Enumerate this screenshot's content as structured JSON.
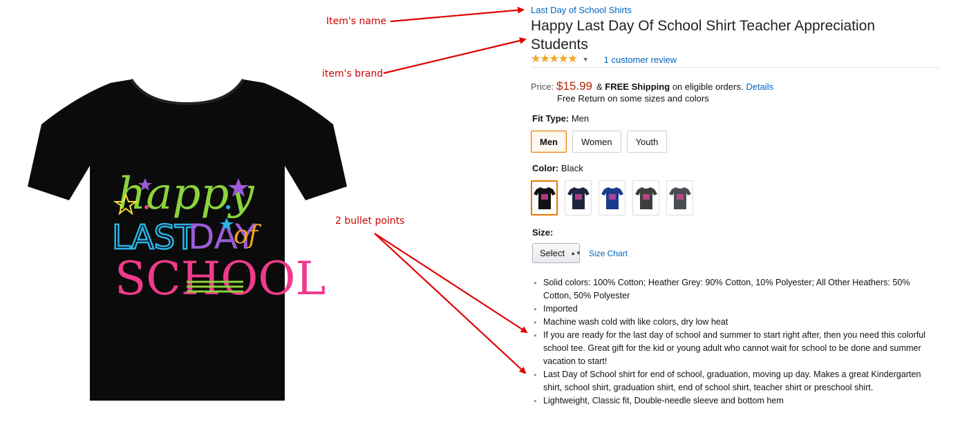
{
  "annotations": {
    "item_name": "Item's name",
    "item_brand": "item's brand",
    "bullet_points": "2 bullet points"
  },
  "product": {
    "brand": "Last Day of School Shirts",
    "title": "Happy Last Day Of School Shirt Teacher Appreciation Students",
    "rating": 5,
    "review_count_label": "1 customer review",
    "price_label": "Price:",
    "price": "$15.99",
    "shipping_amp": "&",
    "free_shipping": "FREE Shipping",
    "shipping_tail": "on eligible orders.",
    "details_link": "Details",
    "free_return": "Free Return on some sizes and colors",
    "fit_type_label": "Fit Type:",
    "fit_type_value": "Men",
    "fit_options": [
      "Men",
      "Women",
      "Youth"
    ],
    "color_label": "Color:",
    "color_value": "Black",
    "color_swatches": [
      "#111111",
      "#1f2540",
      "#1c3a8c",
      "#3d3f3d",
      "#4a4d52"
    ],
    "size_label": "Size:",
    "size_select": "Select",
    "size_chart": "Size Chart",
    "bullets": [
      "Solid colors: 100% Cotton; Heather Grey: 90% Cotton, 10% Polyester; All Other Heathers: 50% Cotton, 50% Polyester",
      "Imported",
      "Machine wash cold with like colors, dry low heat",
      "If you are ready for the last day of school and summer to start right after, then you need this colorful school tee. Great gift for the kid or young adult who cannot wait for school to be done and summer vacation to start!",
      "Last Day of School shirt for end of school, graduation, moving up day. Makes a great Kindergarten shirt, school shirt, graduation shirt, end of school shirt, teacher shirt or preschool shirt.",
      "Lightweight, Classic fit, Double-needle sleeve and bottom hem"
    ],
    "shirt_print": {
      "line1": "happy",
      "line2a": "LAST",
      "line2b": "DAY",
      "line2c": "of",
      "line3": "SCHOOL"
    }
  },
  "colors": {
    "link": "#0066c0",
    "price": "#b12704",
    "annotation": "#cc0000",
    "selected_border": "#e77600"
  }
}
